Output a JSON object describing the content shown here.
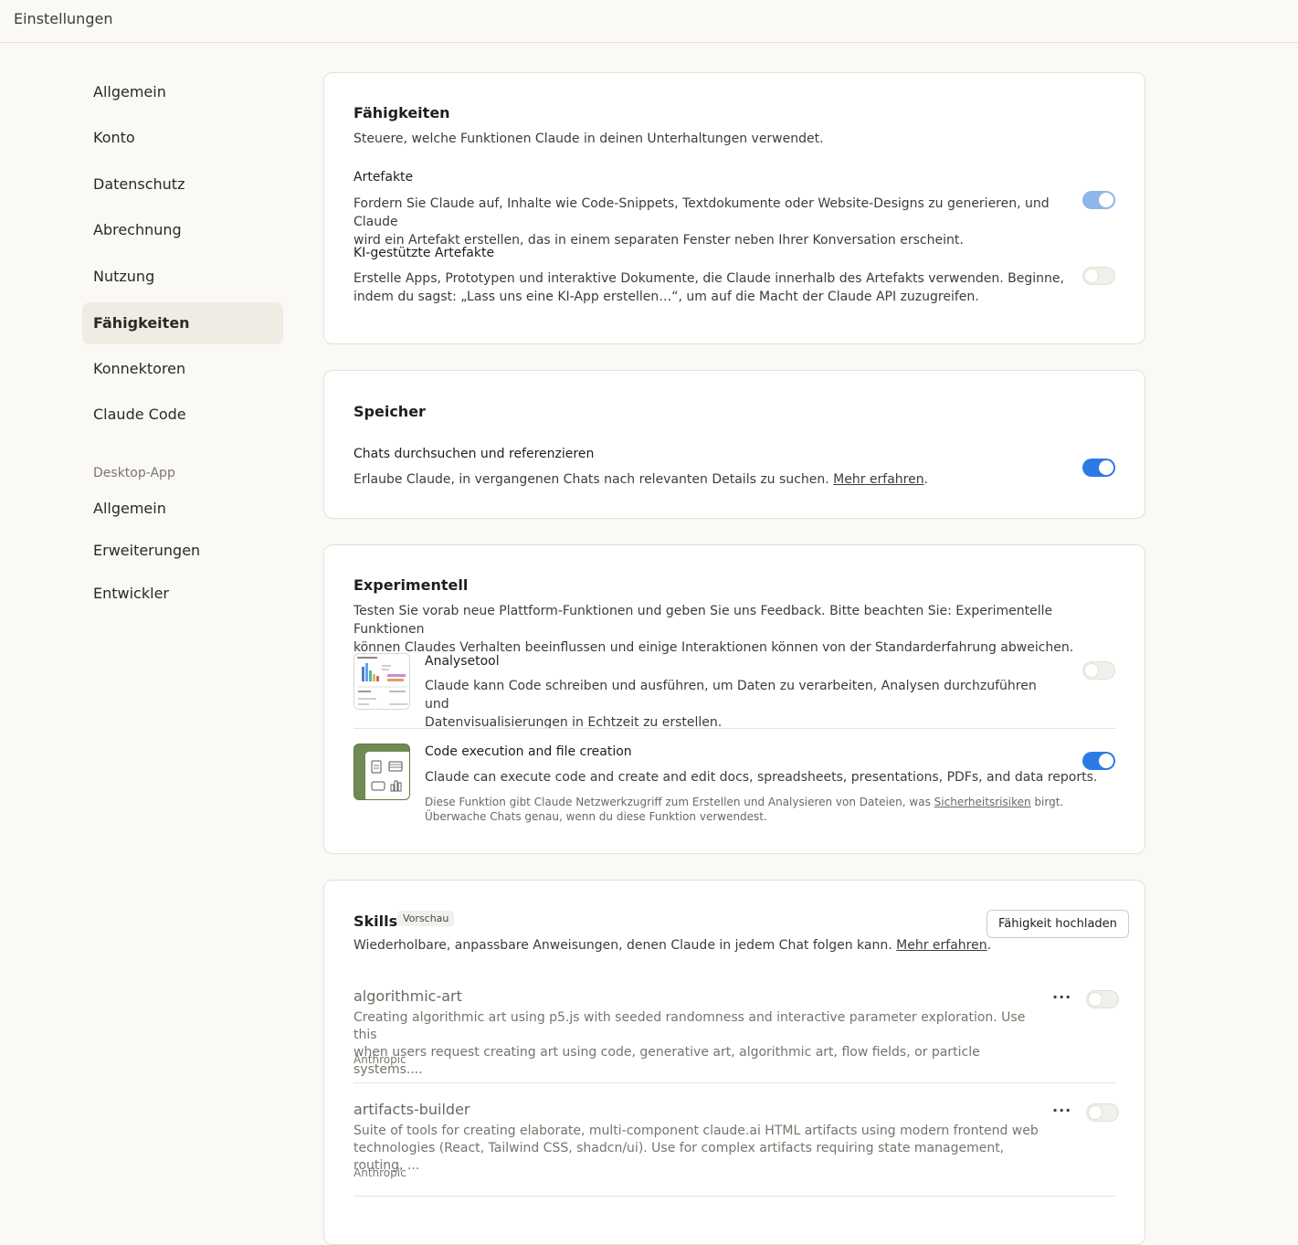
{
  "header": {
    "title": "Einstellungen"
  },
  "sidebar": {
    "items": [
      "Allgemein",
      "Konto",
      "Datenschutz",
      "Abrechnung",
      "Nutzung",
      "Fähigkeiten",
      "Konnektoren",
      "Claude Code"
    ],
    "active": "Fähigkeiten",
    "desktop_section": "Desktop-App",
    "desktop_items": [
      "Allgemein",
      "Erweiterungen",
      "Entwickler"
    ]
  },
  "capabilities": {
    "title": "Fähigkeiten",
    "subtitle": "Steuere, welche Funktionen Claude in deinen Unterhaltungen verwendet.",
    "items": [
      {
        "title": "Artefakte",
        "desc1": "Fordern Sie Claude auf, Inhalte wie Code-Snippets, Textdokumente oder Website-Designs zu generieren, und Claude",
        "desc2": "wird ein Artefakt erstellen, das in einem separaten Fenster neben Ihrer Konversation erscheint.",
        "enabled": true
      },
      {
        "title": "KI-gestützte Artefakte",
        "desc1": "Erstelle Apps, Prototypen und interaktive Dokumente, die Claude innerhalb des Artefakts verwenden. Beginne,",
        "desc2": "indem du sagst: „Lass uns eine KI-App erstellen…“, um auf die Macht der Claude API zuzugreifen.",
        "enabled": false
      }
    ]
  },
  "memory": {
    "title": "Speicher",
    "item_title": "Chats durchsuchen und referenzieren",
    "item_desc": "Erlaube Claude, in vergangenen Chats nach relevanten Details zu suchen.",
    "item_link": "Mehr erfahren",
    "enabled": true
  },
  "experimental": {
    "title": "Experimentell",
    "desc1": "Testen Sie vorab neue Plattform-Funktionen und geben Sie uns Feedback. Bitte beachten Sie: Experimentelle Funktionen",
    "desc2": "können Claudes Verhalten beeinflussen und einige Interaktionen können von der Standarderfahrung abweichen.",
    "analysis": {
      "title": "Analysetool",
      "desc1": "Claude kann Code schreiben und ausführen, um Daten zu verarbeiten, Analysen durchzuführen und",
      "desc2": "Datenvisualisierungen in Echtzeit zu erstellen.",
      "enabled": false
    },
    "code_exec": {
      "title": "Code execution and file creation",
      "desc": "Claude can execute code and create and edit docs, spreadsheets, presentations, PDFs, and data reports.",
      "note1_pre": "Diese Funktion gibt Claude Netzwerkzugriff zum Erstellen und Analysieren von Dateien, was",
      "note1_link": "Sicherheitsrisiken",
      "note1_post": "birgt.",
      "note2": "Überwache Chats genau, wenn du diese Funktion verwendest.",
      "enabled": true
    }
  },
  "skills": {
    "title": "Skills",
    "badge": "Vorschau",
    "upload_label": "Fähigkeit hochladen",
    "desc": "Wiederholbare, anpassbare Anweisungen, denen Claude in jedem Chat folgen kann.",
    "link": "Mehr erfahren",
    "items": [
      {
        "name": "algorithmic-art",
        "desc1": "Creating algorithmic art using p5.js with seeded randomness and interactive parameter exploration. Use this",
        "desc2": "when users request creating art using code, generative art, algorithmic art, flow fields, or particle systems....",
        "author": "Anthropic",
        "enabled": false
      },
      {
        "name": "artifacts-builder",
        "desc1": "Suite of tools for creating elaborate, multi-component claude.ai HTML artifacts using modern frontend web",
        "desc2": "technologies (React, Tailwind CSS, shadcn/ui). Use for complex artifacts requiring state management, routing, ...",
        "author": "Anthropic",
        "enabled": false
      }
    ],
    "more_icon": "ellipsis-icon"
  },
  "colors": {
    "accent": "#2c7be5",
    "accent_faint": "#8fb6ea",
    "background": "#faf9f5",
    "active_nav": "#efece4"
  }
}
